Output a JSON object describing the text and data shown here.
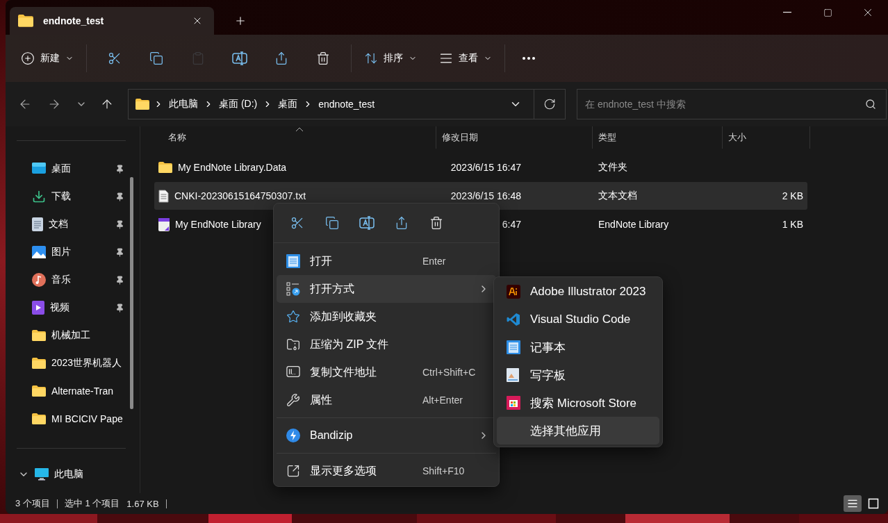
{
  "tab": {
    "title": "endnote_test"
  },
  "toolbar": {
    "new_label": "新建",
    "actions": [
      {
        "kind": "cut",
        "disabled": false
      },
      {
        "kind": "copy",
        "disabled": false
      },
      {
        "kind": "paste",
        "disabled": true
      },
      {
        "kind": "rename",
        "disabled": false
      },
      {
        "kind": "share",
        "disabled": false
      },
      {
        "kind": "delete",
        "disabled": false
      }
    ],
    "sort_label": "排序",
    "view_label": "查看"
  },
  "address": {
    "crumbs": [
      "此电脑",
      "桌面 (D:)",
      "桌面",
      "endnote_test"
    ]
  },
  "search": {
    "placeholder": "在 endnote_test 中搜索"
  },
  "sidebar": {
    "items": [
      {
        "kind": "desktop",
        "label": "桌面",
        "pinned": true
      },
      {
        "kind": "downloads",
        "label": "下载",
        "pinned": true
      },
      {
        "kind": "documents",
        "label": "文档",
        "pinned": true
      },
      {
        "kind": "pictures",
        "label": "图片",
        "pinned": true
      },
      {
        "kind": "music",
        "label": "音乐",
        "pinned": true
      },
      {
        "kind": "videos",
        "label": "视频",
        "pinned": true
      },
      {
        "kind": "folder",
        "label": "机械加工",
        "pinned": false
      },
      {
        "kind": "folder",
        "label": "2023世界机器人",
        "pinned": false
      },
      {
        "kind": "folder",
        "label": "Alternate-Tran",
        "pinned": false
      },
      {
        "kind": "folder",
        "label": "MI BCICIV Pape",
        "pinned": false
      }
    ],
    "pc": {
      "label": "此电脑",
      "expanded": true
    }
  },
  "table": {
    "columns": [
      "名称",
      "修改日期",
      "类型",
      "大小"
    ],
    "rows": [
      {
        "kind": "folder",
        "name": "My EndNote Library.Data",
        "date": "2023/6/15 16:47",
        "type": "文件夹",
        "selected": false
      },
      {
        "kind": "text",
        "name": "CNKI-20230615164750307.txt",
        "date": "2023/6/15 16:48",
        "type": "文本文档",
        "size": "2 KB",
        "selected": true
      },
      {
        "kind": "endnote",
        "name": "My EndNote Library",
        "date": "6:47",
        "type": "EndNote Library",
        "size": "1 KB",
        "selected": false
      }
    ]
  },
  "context_menu": {
    "quick_actions": [
      {
        "kind": "cut"
      },
      {
        "kind": "copy"
      },
      {
        "kind": "rename"
      },
      {
        "kind": "share"
      },
      {
        "kind": "delete"
      }
    ],
    "groups": [
      [
        {
          "kind": "open",
          "label": "打开",
          "shortcut": "Enter",
          "submenu": false,
          "highlighted": false
        },
        {
          "kind": "open_with",
          "label": "打开方式",
          "submenu": true,
          "highlighted": true
        },
        {
          "kind": "favorite",
          "label": "添加到收藏夹",
          "submenu": false,
          "highlighted": false
        },
        {
          "kind": "zip",
          "label": "压缩为 ZIP 文件",
          "submenu": false,
          "highlighted": false
        },
        {
          "kind": "copy_path",
          "label": "复制文件地址",
          "shortcut": "Ctrl+Shift+C",
          "submenu": false,
          "highlighted": false
        },
        {
          "kind": "properties",
          "label": "属性",
          "shortcut": "Alt+Enter",
          "submenu": false,
          "highlighted": false
        }
      ],
      [
        {
          "kind": "bandizip",
          "label": "Bandizip",
          "submenu": true,
          "highlighted": false
        }
      ],
      [
        {
          "kind": "more",
          "label": "显示更多选项",
          "shortcut": "Shift+F10",
          "submenu": false,
          "highlighted": false
        }
      ]
    ]
  },
  "submenu": {
    "items": [
      {
        "kind": "illustrator",
        "label": "Adobe Illustrator 2023",
        "selected": false
      },
      {
        "kind": "vscode",
        "label": "Visual Studio Code",
        "selected": false
      },
      {
        "kind": "notepad",
        "label": "记事本",
        "selected": false
      },
      {
        "kind": "wordpad",
        "label": "写字板",
        "selected": false
      },
      {
        "kind": "store",
        "label": "搜索 Microsoft Store",
        "selected": false
      },
      {
        "kind": "none",
        "label": "选择其他应用",
        "selected": true
      }
    ]
  },
  "status_bar": {
    "count": "3 个项目",
    "selection": "选中 1 个项目",
    "size": "1.67 KB",
    "views": [
      {
        "kind": "details",
        "selected": true
      },
      {
        "kind": "tiles",
        "selected": false
      }
    ]
  }
}
